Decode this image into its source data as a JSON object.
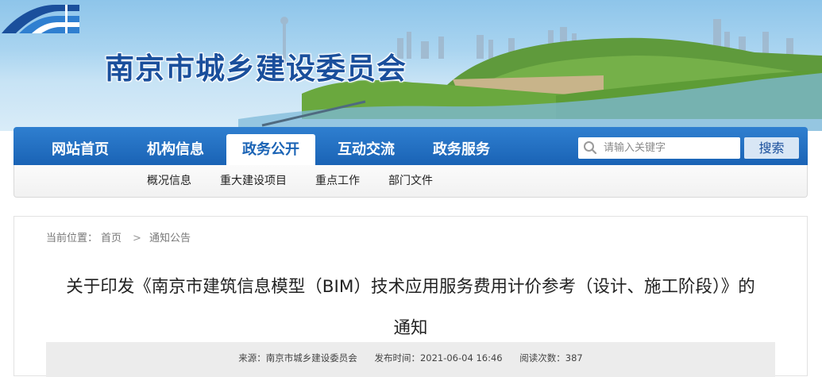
{
  "site": {
    "name": "南京市城乡建设委员会"
  },
  "nav": {
    "items": [
      {
        "label": "网站首页"
      },
      {
        "label": "机构信息"
      },
      {
        "label": "政务公开"
      },
      {
        "label": "互动交流"
      },
      {
        "label": "政务服务"
      }
    ],
    "active": "政务公开"
  },
  "search": {
    "placeholder": "请输入关键字",
    "button": "搜索"
  },
  "subnav": {
    "items": [
      {
        "label": "概况信息"
      },
      {
        "label": "重大建设项目"
      },
      {
        "label": "重点工作"
      },
      {
        "label": "部门文件"
      }
    ]
  },
  "breadcrumb": {
    "prefix": "当前位置：",
    "home": "首页",
    "separator": ">",
    "current": "通知公告"
  },
  "article": {
    "title_line1": "关于印发《南京市建筑信息模型（BIM）技术应用服务费用计价参考（设计、施工阶段）》的",
    "title_line2": "通知",
    "meta": {
      "source": "来源：南京市城乡建设委员会",
      "publish": "发布时间：2021-06-04 16:46",
      "views": "阅读次数：387"
    }
  },
  "colors": {
    "nav_bg": "#1a63b5",
    "brand_text": "#1a4f9c",
    "active_tab_bg": "#ffffff"
  }
}
